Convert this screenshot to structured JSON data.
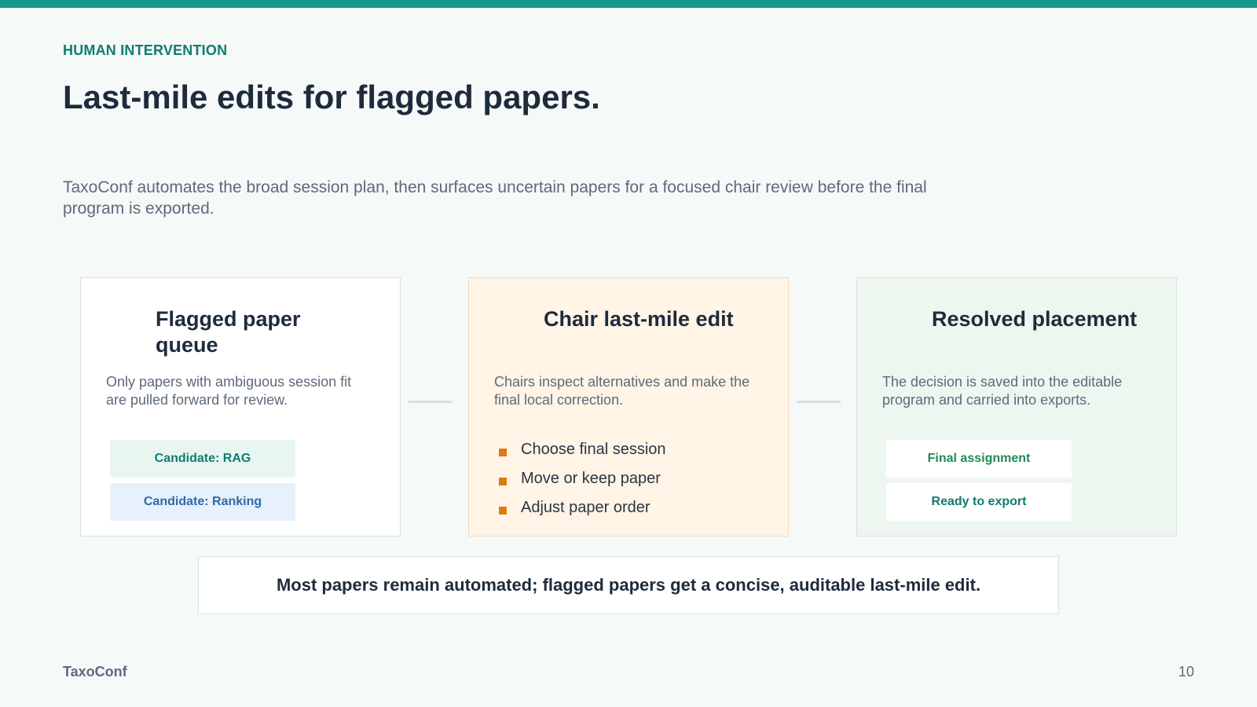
{
  "slide": {
    "eyebrow": "HUMAN INTERVENTION",
    "title": "Last-mile edits for flagged papers.",
    "lede": "TaxoConf automates the broad session plan, then surfaces uncertain papers for a focused chair review before the final program is exported."
  },
  "cards": [
    {
      "title": "Flagged paper queue",
      "description": "Only papers with ambiguous session fit are pulled forward for review.",
      "tags": [
        "Candidate: RAG",
        "Candidate: Ranking"
      ]
    },
    {
      "title": "Chair last-mile edit",
      "description": "Chairs inspect alternatives and make the final local correction.",
      "steps": [
        "Choose final session",
        "Move or keep paper",
        "Adjust paper order"
      ]
    },
    {
      "title": "Resolved placement",
      "description": "The decision is saved into the editable program and carried into exports.",
      "tags": [
        "Final assignment",
        "Ready to export"
      ]
    }
  ],
  "summary": "Most papers remain automated; flagged papers get a concise, auditable last-mile edit.",
  "footer": {
    "brand": "TaxoConf",
    "page_number": "10"
  },
  "colors": {
    "accent": "#14998c",
    "eyebrow": "#0f7c72",
    "bullet": "#dd7a12",
    "card_edit_bg": "#fff4e6",
    "card_resolved_bg": "#edf7f0"
  }
}
